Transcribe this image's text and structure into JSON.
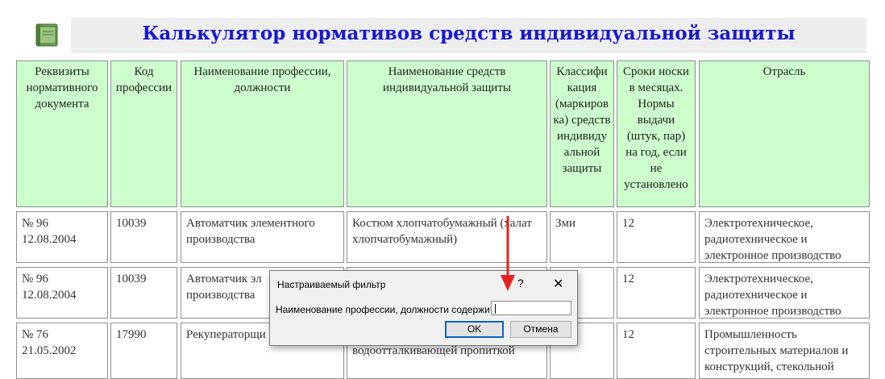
{
  "page": {
    "title": "Калькулятор нормативов средств индивидуальной защиты",
    "logo_icon": "book-icon"
  },
  "table": {
    "headers": [
      "Реквизиты нормативного документа",
      "Код профессии",
      "Наименование профессии, должности",
      "Наименование средств индивидуальной защиты",
      "Классифи кация (маркиров ка) средств индивиду альной защиты",
      "Сроки носки в месяцах. Нормы выдачи (штук, пар) на год, если не установлено",
      "Отрасль"
    ],
    "rows": [
      {
        "doc": "№ 96 12.08.2004",
        "code": "10039",
        "profession": "Автоматчик элементного производства",
        "ppe": "Костюм хлопчатобумажный (халат хлопчатобумажный)",
        "class": "Зми",
        "term": "12",
        "industry": "Электротехническое, радиотехническое и электронное производство"
      },
      {
        "doc": "№ 96 12.08.2004",
        "code": "10039",
        "profession": "Автоматчик эл",
        "profession_line2": "производства",
        "ppe": "",
        "class": "",
        "term": "12",
        "industry": "Электротехническое, радиотехническое и электронное производство"
      },
      {
        "doc": "№ 76 21.05.2002",
        "code": "17990",
        "profession": "Рекуператорщи",
        "ppe": "водоотталкивающей пропиткой",
        "class": "",
        "term": "12",
        "industry": "Промышленность строительных материалов и конструкций, стекольной"
      }
    ]
  },
  "dialog": {
    "title": "Настраиваемый фильтр",
    "help": "?",
    "close": "✕",
    "label": "Наименование профессии, должности содержит",
    "input_value": "",
    "ok": "OK",
    "cancel": "Отмена"
  },
  "colors": {
    "header_bg": "#ccffcc",
    "title_color": "#1818d6",
    "arrow": "#e82020"
  }
}
